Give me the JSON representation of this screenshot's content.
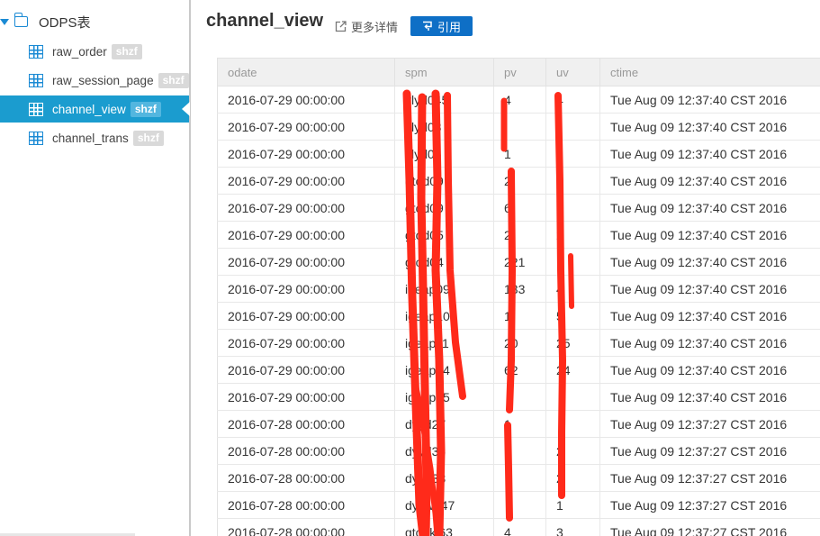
{
  "sidebar": {
    "root_label": "ODPS表",
    "items": [
      {
        "name": "raw_order",
        "badge": "shzf"
      },
      {
        "name": "raw_session_page",
        "badge": "shzf"
      },
      {
        "name": "channel_view",
        "badge": "shzf"
      },
      {
        "name": "channel_trans",
        "badge": "shzf"
      }
    ]
  },
  "header": {
    "title": "channel_view",
    "detail_label": "更多详情",
    "ref_label": "引用"
  },
  "table": {
    "columns": [
      "odate",
      "spm",
      "pv",
      "uv",
      "ctime"
    ],
    "rows": [
      [
        "2016-07-29 00:00:00",
        "ylyd045",
        "4",
        "4",
        "Tue Aug 09 12:37:40 CST 2016"
      ],
      [
        "2016-07-29 00:00:00",
        "ylyd03",
        "",
        "",
        "Tue Aug 09 12:37:40 CST 2016"
      ],
      [
        "2016-07-29 00:00:00",
        "ylyd06",
        "1",
        "",
        "Tue Aug 09 12:37:40 CST 2016"
      ],
      [
        "2016-07-29 00:00:00",
        "gtod09",
        "2",
        "6",
        "Tue Aug 09 12:37:40 CST 2016"
      ],
      [
        "2016-07-29 00:00:00",
        "gtod09",
        "6",
        "6",
        "Tue Aug 09 12:37:40 CST 2016"
      ],
      [
        "2016-07-29 00:00:00",
        "gtod05",
        "2",
        "2",
        "Tue Aug 09 12:37:40 CST 2016"
      ],
      [
        "2016-07-29 00:00:00",
        "gtod04",
        "221",
        "",
        "Tue Aug 09 12:37:40 CST 2016"
      ],
      [
        "2016-07-29 00:00:00",
        "igeap09",
        "133",
        "4",
        "Tue Aug 09 12:37:40 CST 2016"
      ],
      [
        "2016-07-29 00:00:00",
        "igeap10",
        "1",
        "5",
        "Tue Aug 09 12:37:40 CST 2016"
      ],
      [
        "2016-07-29 00:00:00",
        "igeap11",
        "20",
        "25",
        "Tue Aug 09 12:37:40 CST 2016"
      ],
      [
        "2016-07-29 00:00:00",
        "igeap14",
        "62",
        "24",
        "Tue Aug 09 12:37:40 CST 2016"
      ],
      [
        "2016-07-29 00:00:00",
        "igeap15",
        "",
        "",
        "Tue Aug 09 12:37:40 CST 2016"
      ],
      [
        "2016-07-28 00:00:00",
        "dyyd27",
        "1",
        "",
        "Tue Aug 09 12:37:27 CST 2016"
      ],
      [
        "2016-07-28 00:00:00",
        "dyyd35",
        "",
        "2",
        "Tue Aug 09 12:37:27 CST 2016"
      ],
      [
        "2016-07-28 00:00:00",
        "dyyd38",
        "",
        "2",
        "Tue Aug 09 12:37:27 CST 2016"
      ],
      [
        "2016-07-28 00:00:00",
        "dyyw047",
        "",
        "1",
        "Tue Aug 09 12:37:27 CST 2016"
      ],
      [
        "2016-07-28 00:00:00",
        "gtodkj63",
        "4",
        "3",
        "Tue Aug 09 12:37:27 CST 2016"
      ]
    ]
  },
  "colors": {
    "accent": "#1b9ccf",
    "button": "#0e6fc6",
    "redaction": "#ff2a1a"
  }
}
